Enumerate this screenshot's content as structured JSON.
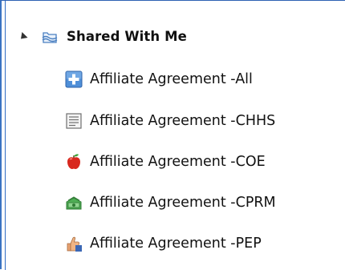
{
  "tree": {
    "root": {
      "label": "Shared With Me",
      "expanded": true,
      "icon": "shared-folder-icon"
    },
    "children": [
      {
        "label": "Affiliate Agreement -All",
        "icon": "blue-plus-icon"
      },
      {
        "label": "Affiliate Agreement -CHHS",
        "icon": "document-list-icon"
      },
      {
        "label": "Affiliate Agreement -COE",
        "icon": "apple-icon"
      },
      {
        "label": "Affiliate Agreement -CPRM",
        "icon": "money-icon"
      },
      {
        "label": "Affiliate Agreement -PEP",
        "icon": "thumbs-up-icon"
      }
    ]
  },
  "colors": {
    "border": "#3a73c2",
    "text": "#111111"
  }
}
